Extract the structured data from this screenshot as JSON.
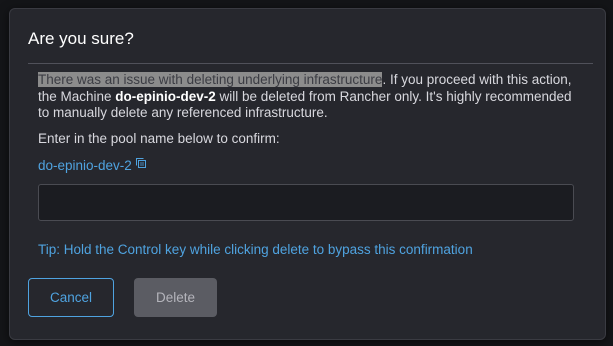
{
  "dialog": {
    "title": "Are you sure?",
    "message": {
      "highlighted": "There was an issue with deleting underlying infrastructure",
      "part1": ". If you proceed with this action, the Machine ",
      "machine_name": "do-epinio-dev-2",
      "part2": " will be deleted from Rancher only. It's highly recommended to manually delete any referenced infrastructure."
    },
    "confirm_label": "Enter in the pool name below to confirm:",
    "pool_name": "do-epinio-dev-2",
    "input_value": "",
    "tip": "Tip: Hold the Control key while clicking delete to bypass this confirmation",
    "cancel_label": "Cancel",
    "delete_label": "Delete"
  },
  "icons": {
    "copy": "copy-icon"
  },
  "colors": {
    "accent": "#4fa3e0",
    "modal_bg": "#26272d",
    "highlight_bg": "#8c8c8c",
    "disabled_button": "#5b5c63"
  }
}
